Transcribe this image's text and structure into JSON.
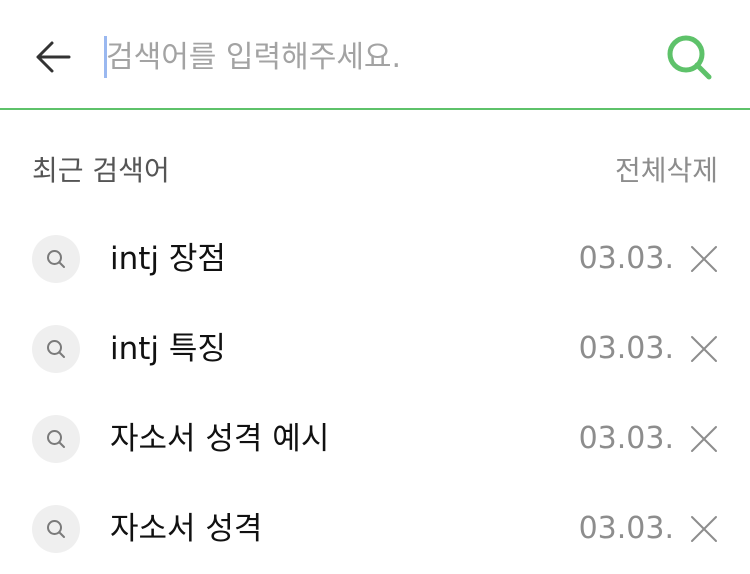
{
  "search": {
    "placeholder": "검색어를 입력해주세요.",
    "value": "",
    "accent_color": "#5ec26a",
    "back_icon": "arrow-left-icon",
    "search_icon": "search-icon"
  },
  "recent": {
    "title": "최근 검색어",
    "clear_all_label": "전체삭제",
    "items": [
      {
        "term": "intj 장점",
        "date": "03.03."
      },
      {
        "term": "intj 특징",
        "date": "03.03."
      },
      {
        "term": "자소서 성격 예시",
        "date": "03.03."
      },
      {
        "term": "자소서 성격",
        "date": "03.03."
      }
    ]
  }
}
